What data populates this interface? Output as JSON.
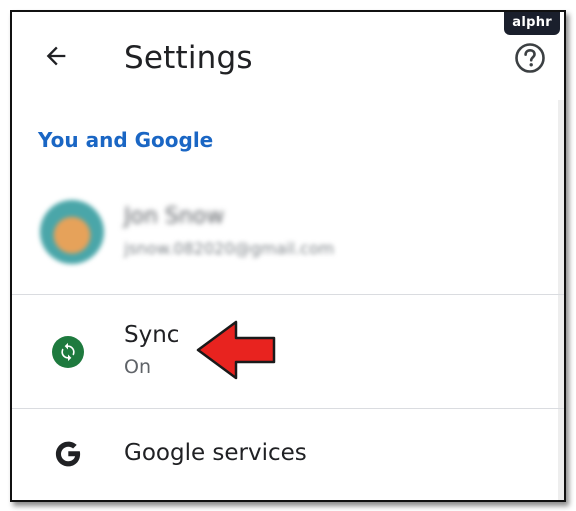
{
  "watermark": "alphr",
  "header": {
    "title": "Settings",
    "back_icon": "arrow-back-icon",
    "help_icon": "help-icon"
  },
  "section": {
    "title": "You and Google"
  },
  "account": {
    "name": "Jon Snow",
    "email": "jsnow.082020@gmail.com"
  },
  "sync": {
    "label": "Sync",
    "status": "On",
    "icon": "sync-icon",
    "icon_color": "#1e7a3e"
  },
  "services": {
    "label": "Google services",
    "icon": "google-g-icon"
  },
  "colors": {
    "accent": "#1a66c4",
    "annotation_arrow": "#e8231f"
  }
}
